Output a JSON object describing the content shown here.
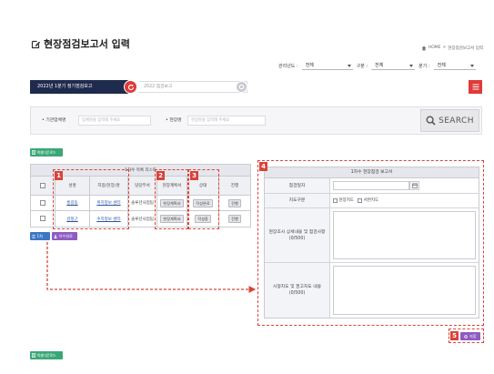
{
  "page": {
    "title": "현장점검보고서 입력"
  },
  "breadcrumb": {
    "home": "HOME",
    "separator": ">",
    "current": "현장점검보고서 입력"
  },
  "filters": {
    "year": {
      "label": "관리년도 :",
      "value": "전체"
    },
    "type": {
      "label": "구분 :",
      "value": "전체"
    },
    "quarter": {
      "label": "분기 :",
      "value": "전체"
    }
  },
  "report_bar": {
    "selected_report": "2022년 1분기 정기점검보고",
    "report_name": "2022 점검보고"
  },
  "search": {
    "field1_label": "• 기관업체명",
    "field1_placeholder": "업체명을 입력해 주세요",
    "field2_label": "• 현장명",
    "field2_placeholder": "현장명을 입력해 주세요",
    "button_label": "SEARCH"
  },
  "excel_download_label": "엑셀다운로드",
  "list_table": {
    "title": "1차수 목록 리스트",
    "columns": [
      "성명",
      "지점(현장)명",
      "담당부서",
      "현장계획서",
      "상태",
      "진행"
    ],
    "rows": [
      {
        "name": "홍길동",
        "site": "위치정보 센터",
        "department": "솔루션사업팀",
        "plan": "현장계획서",
        "status": "작성완료",
        "action": "진행"
      },
      {
        "name": "김정근",
        "site": "수지정보 센터",
        "department": "솔루션사업팀",
        "plan": "현장계획서",
        "status": "작성중",
        "action": "진행"
      }
    ]
  },
  "list_actions": {
    "round_label": "1차",
    "complete_label": "이수완료"
  },
  "report_panel": {
    "title": "1차수 현장점검 보고서",
    "date_label": "점검일자",
    "guidance_label": "지도구분",
    "guidance_options": [
      "현장지도",
      "서면지도"
    ],
    "findings_label": "현장조사 상세내용 및 점검사항",
    "findings_counter": "(0/500)",
    "actions_label": "시정지도 및 권고지도 내용",
    "actions_counter": "(0/500)"
  },
  "save_label": "저장",
  "annotation_markers": [
    "1",
    "2",
    "3",
    "4",
    "5"
  ],
  "icons": [
    "edit-icon",
    "home-icon",
    "refresh-icon",
    "reset-icon",
    "menu-icon",
    "search-icon",
    "excel-icon",
    "list-icon",
    "user-icon",
    "calendar-icon",
    "gear-icon"
  ],
  "colors": {
    "navy": "#1f2b4d",
    "accent_red": "#e03a3a",
    "excel_green": "#3aa876",
    "blue_button": "#3b78c4",
    "purple_button": "#8e5cc2",
    "annotation_red": "#d9433a",
    "link_blue": "#2a55a5"
  }
}
